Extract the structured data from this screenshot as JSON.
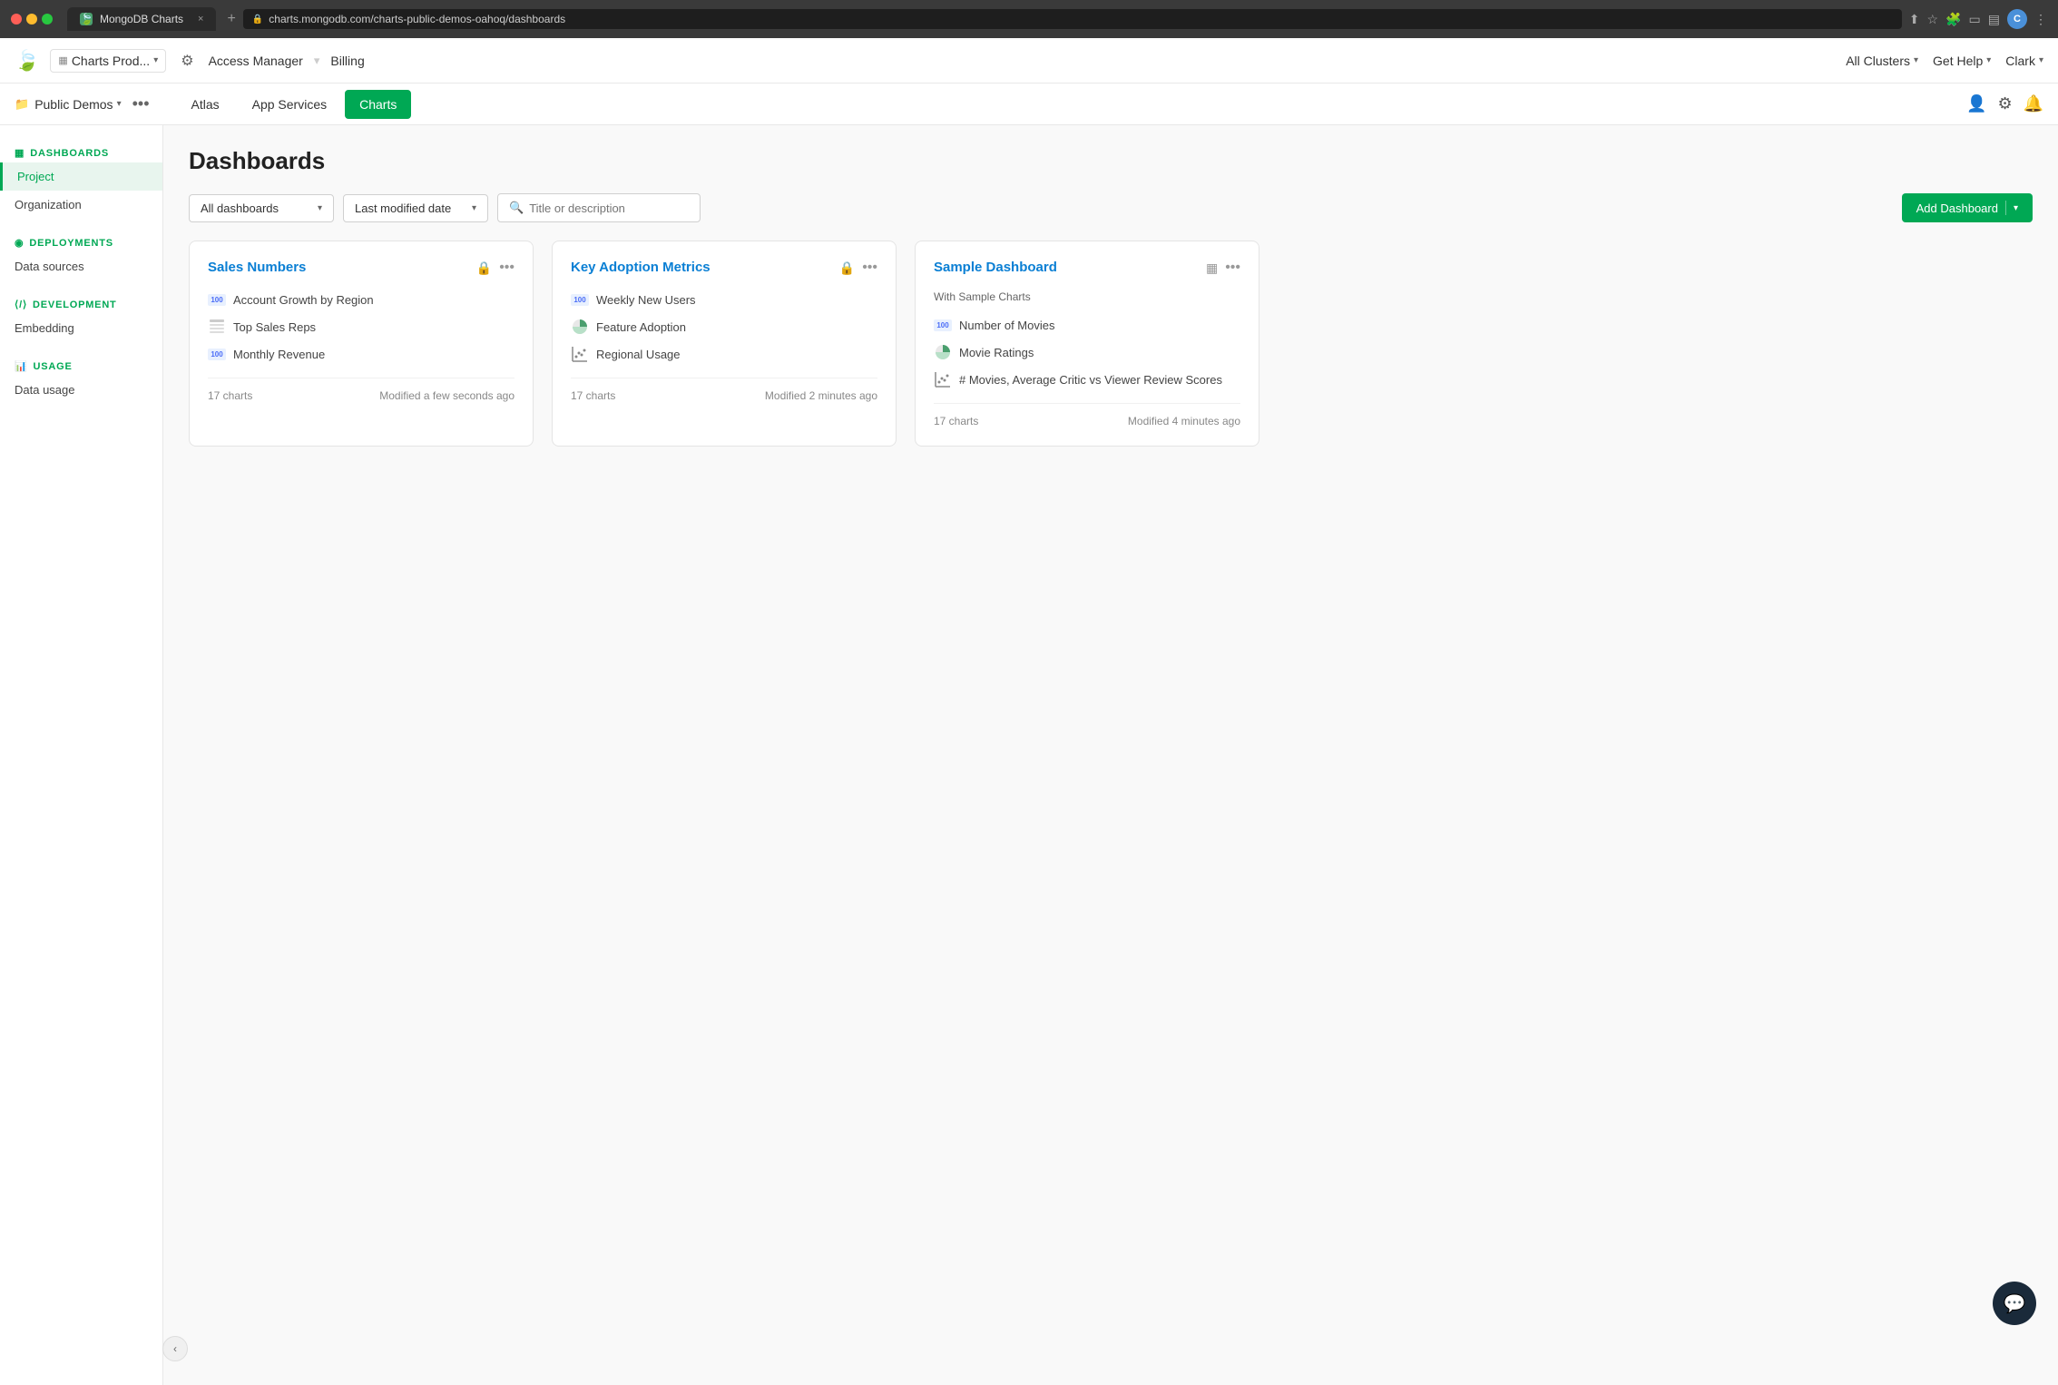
{
  "browser": {
    "tab_icon": "🍃",
    "tab_title": "MongoDB Charts",
    "tab_close": "×",
    "tab_new": "+",
    "address": "charts.mongodb.com/charts-public-demos-oahoq/dashboards",
    "user_avatar": "C"
  },
  "top_nav": {
    "logo": "🍃",
    "app_name": "Charts Prod...",
    "gear_label": "⚙",
    "access_manager": "Access Manager",
    "billing": "Billing",
    "all_clusters": "All Clusters",
    "get_help": "Get Help",
    "user_name": "Clark"
  },
  "sub_nav": {
    "folder_icon": "📁",
    "project_name": "Public Demos",
    "tabs": [
      {
        "id": "atlas",
        "label": "Atlas",
        "active": false
      },
      {
        "id": "app-services",
        "label": "App Services",
        "active": false
      },
      {
        "id": "charts",
        "label": "Charts",
        "active": true
      }
    ],
    "icons": {
      "user": "👤",
      "settings": "⚙",
      "bell": "🔔"
    }
  },
  "sidebar": {
    "sections": [
      {
        "id": "dashboards",
        "label": "DASHBOARDS",
        "icon": "▦",
        "items": [
          {
            "id": "project",
            "label": "Project",
            "active": true
          },
          {
            "id": "organization",
            "label": "Organization",
            "active": false
          }
        ]
      },
      {
        "id": "deployments",
        "label": "DEPLOYMENTS",
        "icon": "◉",
        "items": [
          {
            "id": "data-sources",
            "label": "Data sources",
            "active": false
          }
        ]
      },
      {
        "id": "development",
        "label": "DEVELOPMENT",
        "icon": "⟨/⟩",
        "items": [
          {
            "id": "embedding",
            "label": "Embedding",
            "active": false
          }
        ]
      },
      {
        "id": "usage",
        "label": "USAGE",
        "icon": "📊",
        "items": [
          {
            "id": "data-usage",
            "label": "Data usage",
            "active": false
          }
        ]
      }
    ]
  },
  "main": {
    "page_title": "Dashboards",
    "toolbar": {
      "filter_label": "All dashboards",
      "sort_label": "Last modified date",
      "search_placeholder": "Title or description",
      "add_button_label": "Add Dashboard"
    },
    "cards": [
      {
        "id": "sales-numbers",
        "title": "Sales Numbers",
        "description": "",
        "charts": [
          {
            "id": "account-growth",
            "icon_type": "bar",
            "icon_label": "100",
            "name": "Account Growth by Region"
          },
          {
            "id": "top-sales",
            "icon_type": "table",
            "name": "Top Sales Reps"
          },
          {
            "id": "monthly-revenue",
            "icon_type": "bar",
            "icon_label": "100",
            "name": "Monthly Revenue"
          }
        ],
        "chart_count": "17 charts",
        "modified": "Modified a few seconds ago",
        "has_lock": true,
        "has_grid": false
      },
      {
        "id": "key-adoption",
        "title": "Key Adoption Metrics",
        "description": "",
        "charts": [
          {
            "id": "weekly-users",
            "icon_type": "bar",
            "icon_label": "100",
            "name": "Weekly New Users"
          },
          {
            "id": "feature-adoption",
            "icon_type": "pie",
            "name": "Feature Adoption"
          },
          {
            "id": "regional-usage",
            "icon_type": "scatter",
            "name": "Regional Usage"
          }
        ],
        "chart_count": "17 charts",
        "modified": "Modified 2 minutes ago",
        "has_lock": true,
        "has_grid": false
      },
      {
        "id": "sample-dashboard",
        "title": "Sample Dashboard",
        "description": "With Sample Charts",
        "charts": [
          {
            "id": "number-movies",
            "icon_type": "bar",
            "icon_label": "100",
            "name": "Number of Movies"
          },
          {
            "id": "movie-ratings",
            "icon_type": "pie",
            "name": "Movie Ratings"
          },
          {
            "id": "movies-scores",
            "icon_type": "scatter",
            "name": "# Movies, Average Critic vs Viewer Review Scores"
          }
        ],
        "chart_count": "17 charts",
        "modified": "Modified 4 minutes ago",
        "has_lock": false,
        "has_grid": true
      }
    ]
  },
  "icons": {
    "chevron_down": "▾",
    "chevron_left": "‹",
    "lock": "🔒",
    "more": "•••",
    "search": "🔍",
    "grid": "▦",
    "folder": "📁",
    "collapse": "‹"
  }
}
